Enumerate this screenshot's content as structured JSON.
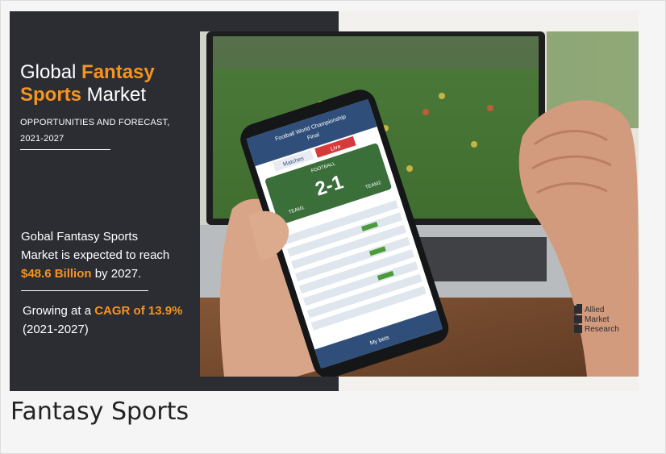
{
  "banner": {
    "title_part1": "Global ",
    "title_hl1": "Fantasy",
    "title_hl2": "Sports",
    "title_part2": " Market",
    "subtitle_line1": "OPPORTUNITIES AND FORECAST,",
    "subtitle_line2": "2021-2027",
    "expect_line1": "Gobal Fantasy Sports",
    "expect_line2": "Market is expected to reach",
    "expect_value": "$48.6 Billion",
    "expect_tail": " by 2027.",
    "growth_prefix": "Growing at a ",
    "growth_value": "CAGR of 13.9%",
    "growth_period": "(2021-2027)",
    "logo_line1": "Allied",
    "logo_line2": "Market",
    "logo_line3": "Research"
  },
  "phone": {
    "header_title": "Football World Championship",
    "header_sub": "Final",
    "tab_matches": "Matches",
    "tab_live": "Live",
    "sport_label": "FOOTBALL",
    "score": "2-1",
    "team_left": "TEAM1",
    "team_right": "TEAM2",
    "bottom_label": "My bets"
  },
  "caption": "Fantasy Sports",
  "colors": {
    "accent": "#f7941d",
    "panel": "#2b2d33"
  }
}
